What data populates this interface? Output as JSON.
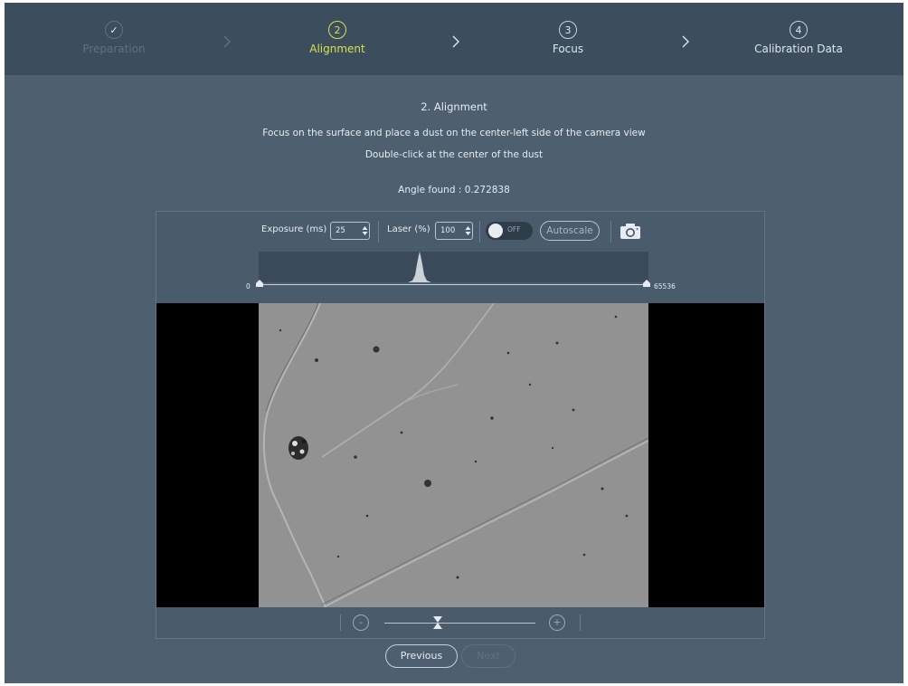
{
  "stepper": {
    "steps": [
      {
        "number": "✓",
        "label": "Preparation",
        "state": "done"
      },
      {
        "number": "2",
        "label": "Alignment",
        "state": "active"
      },
      {
        "number": "3",
        "label": "Focus",
        "state": "pending"
      },
      {
        "number": "4",
        "label": "Calibration Data",
        "state": "pending"
      }
    ],
    "colors": {
      "active": "#d6e14a",
      "done": "#5f7184",
      "pending": "#dfe6ed"
    }
  },
  "instructions": {
    "title": "2. Alignment",
    "line1": "Focus on the surface and place a dust on the center-left side of the camera view",
    "line2": "Double-click at the center of the dust",
    "angle": "Angle found : 0.272838"
  },
  "toolbar": {
    "exposure_label": "Exposure (ms)",
    "exposure_value": "25",
    "laser_label": "Laser (%)",
    "laser_value": "100",
    "toggle_state": "OFF",
    "autoscale_label": "Autoscale",
    "camera_icon": "camera-icon"
  },
  "histogram": {
    "min_label": "0",
    "max_label": "65536"
  },
  "zoom": {
    "minus_label": "-",
    "plus_label": "+",
    "level": 0.48
  },
  "nav": {
    "previous_label": "Previous",
    "next_label": "Next"
  }
}
